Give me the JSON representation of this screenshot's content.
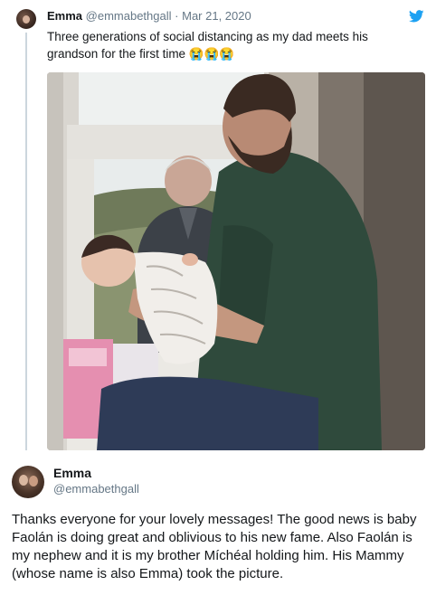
{
  "quoted_tweet": {
    "author_name": "Emma",
    "handle": "@emmabethgall",
    "separator": "·",
    "date": "Mar 21, 2020",
    "text": "Three generations of social distancing as my dad meets his grandson for the first time 😭😭😭",
    "logo_icon": "twitter-bird-icon",
    "photo_icon": "photo-grandfather-window-baby"
  },
  "reply_tweet": {
    "author_name": "Emma",
    "handle": "@emmabethgall",
    "text": "Thanks everyone for your lovely messages! The good news is baby Faolán is doing great and oblivious to his new fame. Also Faolán is my nephew and it is my brother Míchéal holding him. His Mammy (whose name is also Emma) took the picture."
  },
  "colors": {
    "text_primary": "#14171a",
    "text_secondary": "#657786",
    "twitter_blue": "#1da1f2",
    "thread_line": "#ccd6dd"
  }
}
